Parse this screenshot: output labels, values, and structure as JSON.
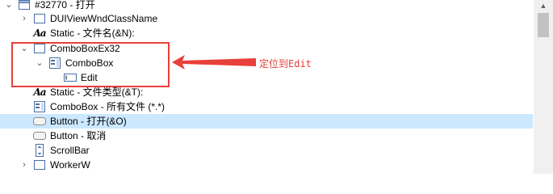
{
  "tree": {
    "window_node": "#32770 - 打开",
    "items": [
      {
        "label": "DUIViewWndClassName"
      },
      {
        "label": "Static - 文件名(&N):"
      },
      {
        "label": "ComboBoxEx32"
      },
      {
        "label": "ComboBox"
      },
      {
        "label": "Edit"
      },
      {
        "label": "Static - 文件类型(&T):"
      },
      {
        "label": "ComboBox - 所有文件 (*.*)"
      },
      {
        "label": "Button - 打开(&O)"
      },
      {
        "label": "Button - 取消"
      },
      {
        "label": "ScrollBar"
      },
      {
        "label": "WorkerW"
      }
    ],
    "static_icon_text": "Aa"
  },
  "annotation": {
    "text": "定位到Edit",
    "color": "#e8403a"
  },
  "colors": {
    "selection": "#cce8ff",
    "scrollbar_track": "#f0f0f0",
    "scrollbar_thumb": "#c2c2c2"
  }
}
